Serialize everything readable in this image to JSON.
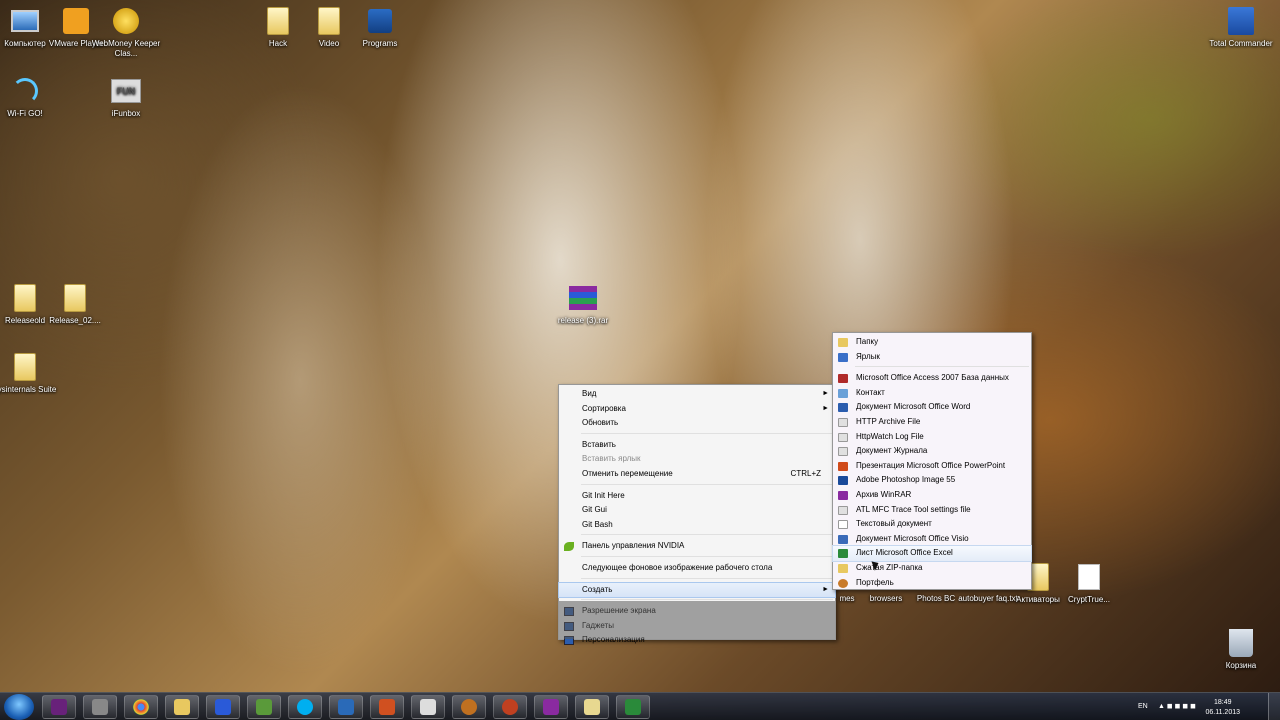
{
  "desktop_icons": {
    "computer": "Компьютер",
    "vmware": "VMware Player",
    "webmoney": "WebMoney Keeper Clas...",
    "hack": "Hack",
    "video": "Video",
    "programs": "Programs",
    "total_commander": "Total Commander",
    "wifi": "Wi-Fi GO!",
    "ifunbox": "iFunbox",
    "releaseold": "Releaseold",
    "release02": "Release_02....",
    "sysinternals": "sysinternals Suite",
    "release_rar": "release (3).rar",
    "partial_left": "mes",
    "browsers": "browsers",
    "photos_bc": "Photos BC",
    "autobuyer": "autobuyer faq.txt",
    "activators": "Активаторы",
    "cryptrue": "CryptTrue...",
    "recycle_bin": "Корзина"
  },
  "context_menu": {
    "view": "Вид",
    "sort": "Сортировка",
    "refresh": "Обновить",
    "paste": "Вставить",
    "paste_shortcut": "Вставить ярлык",
    "undo_move": "Отменить перемещение",
    "undo_shortcut": "CTRL+Z",
    "git_init": "Git Init Here",
    "git_gui": "Git Gui",
    "git_bash": "Git Bash",
    "nvidia": "Панель управления NVIDIA",
    "next_bg": "Следующее фоновое изображение рабочего стола",
    "create": "Создать",
    "resolution": "Разрешение экрана",
    "gadgets": "Гаджеты",
    "personalize": "Персонализация"
  },
  "submenu": {
    "items": [
      "Папку",
      "Ярлык",
      "Microsoft Office Access 2007 База данных",
      "Контакт",
      "Документ Microsoft Office Word",
      "HTTP Archive File",
      "HttpWatch Log File",
      "Документ Журнала",
      "Презентация Microsoft Office PowerPoint",
      "Adobe Photoshop Image 55",
      "Архив WinRAR",
      "ATL MFC Trace Tool settings file",
      "Текстовый документ",
      "Документ Microsoft Office Visio",
      "Лист Microsoft Office Excel",
      "Сжатая ZIP-папка",
      "Портфель"
    ]
  },
  "taskbar": {
    "lang": "EN",
    "time": "18:49",
    "date": "06.11.2013"
  }
}
